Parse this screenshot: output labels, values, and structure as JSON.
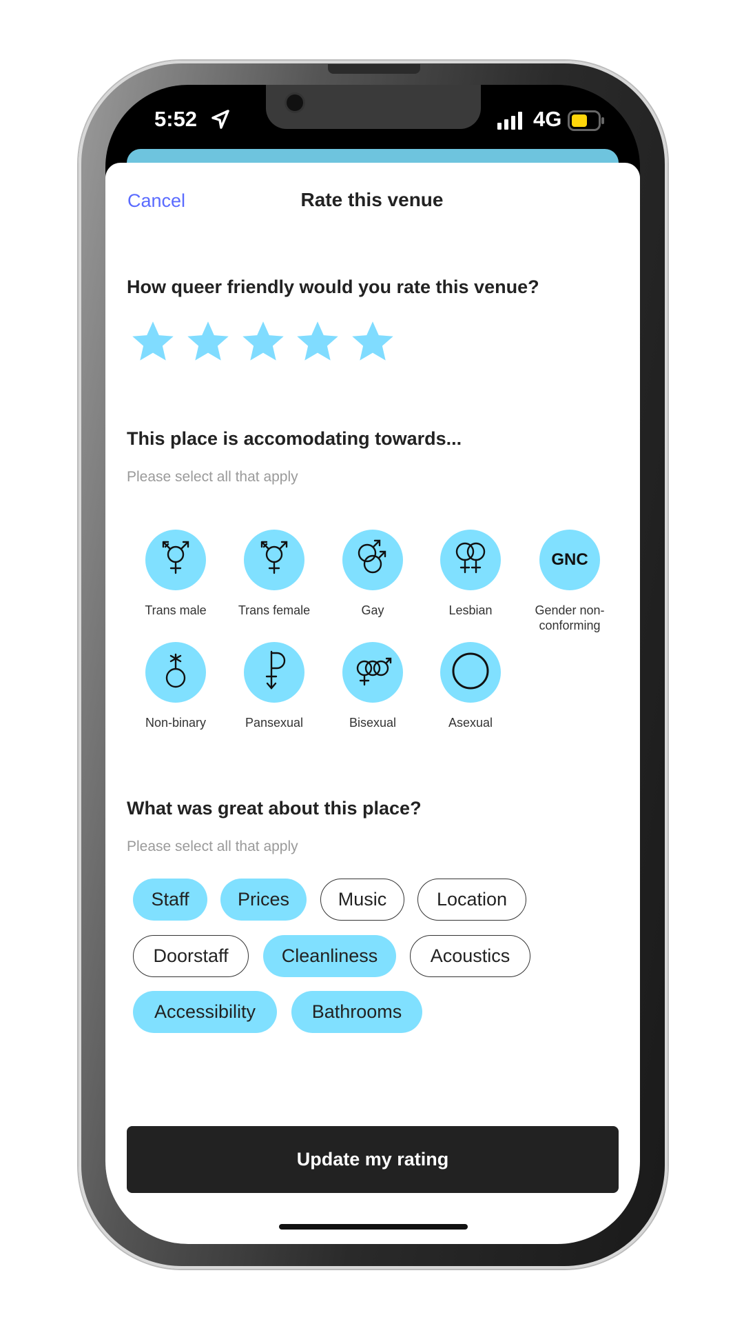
{
  "status_bar": {
    "time": "5:52",
    "network": "4G",
    "battery_color": "#ffd60a"
  },
  "header": {
    "cancel": "Cancel",
    "title": "Rate this venue"
  },
  "rating": {
    "question": "How queer friendly would you rate this venue?",
    "stars": 5,
    "max_stars": 5,
    "star_color": "#80dcff"
  },
  "identities": {
    "heading": "This place is accomodating towards...",
    "subtitle": "Please select all that apply",
    "items": [
      {
        "label": "Trans male",
        "icon": "transgender-symbol"
      },
      {
        "label": "Trans female",
        "icon": "transgender-symbol"
      },
      {
        "label": "Gay",
        "icon": "double-male-symbol"
      },
      {
        "label": "Lesbian",
        "icon": "double-female-symbol"
      },
      {
        "label": "Gender non-conforming",
        "icon": "gnc-text",
        "icon_text": "GNC"
      },
      {
        "label": "Non-binary",
        "icon": "nonbinary-symbol"
      },
      {
        "label": "Pansexual",
        "icon": "pansexual-symbol"
      },
      {
        "label": "Bisexual",
        "icon": "bisexual-symbol"
      },
      {
        "label": "Asexual",
        "icon": "asexual-circle"
      }
    ]
  },
  "great": {
    "heading": "What was great about this place?",
    "subtitle": "Please select all that apply",
    "chips": [
      {
        "label": "Staff",
        "selected": true
      },
      {
        "label": "Prices",
        "selected": true
      },
      {
        "label": "Music",
        "selected": false
      },
      {
        "label": "Location",
        "selected": false
      },
      {
        "label": "Doorstaff",
        "selected": false
      },
      {
        "label": "Cleanliness",
        "selected": true
      },
      {
        "label": "Acoustics",
        "selected": false
      },
      {
        "label": "Accessibility",
        "selected": true
      },
      {
        "label": "Bathrooms",
        "selected": true
      }
    ]
  },
  "submit": {
    "label": "Update my rating"
  },
  "colors": {
    "accent": "#80e0ff",
    "cancel": "#5a6bff",
    "button": "#222222",
    "card": "#6ec4de"
  }
}
